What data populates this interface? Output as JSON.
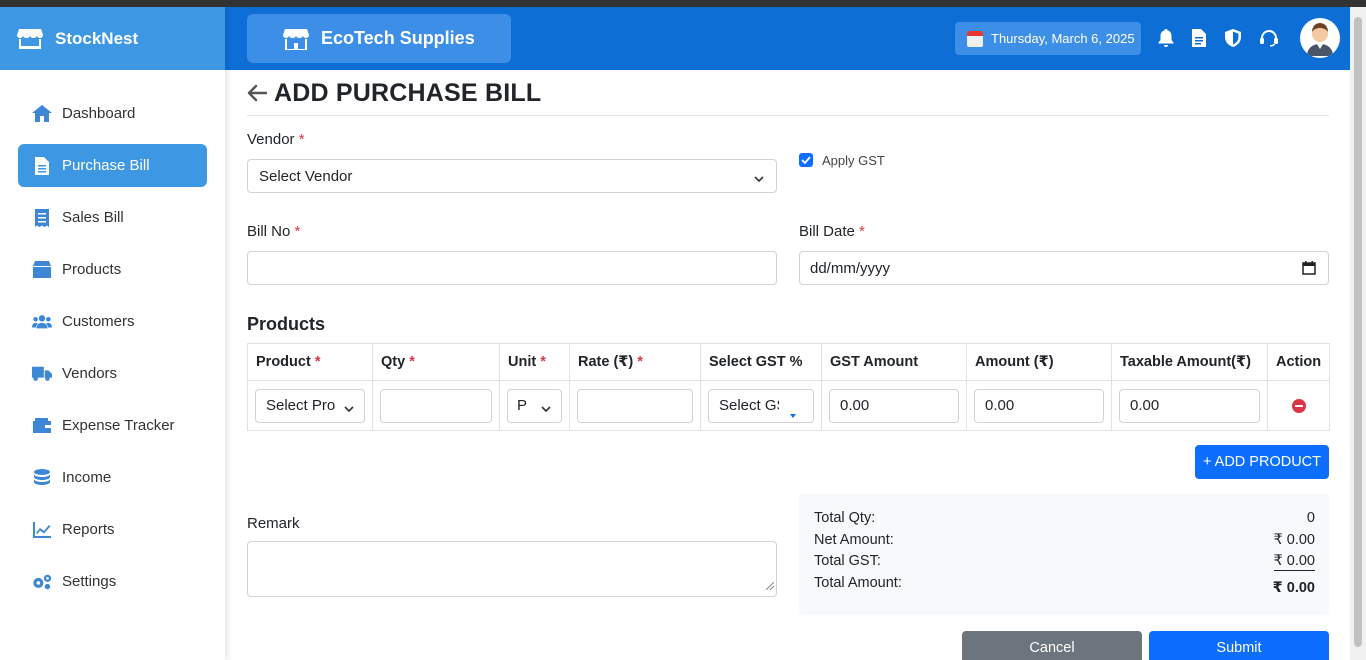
{
  "app": {
    "name": "StockNest"
  },
  "header": {
    "company": "EcoTech Supplies",
    "date": "Thursday, March 6, 2025"
  },
  "sidebar": {
    "items": [
      {
        "label": "Dashboard",
        "icon": "home-icon"
      },
      {
        "label": "Purchase Bill",
        "icon": "file-icon",
        "active": true
      },
      {
        "label": "Sales Bill",
        "icon": "receipt-icon"
      },
      {
        "label": "Products",
        "icon": "box-icon"
      },
      {
        "label": "Customers",
        "icon": "users-icon"
      },
      {
        "label": "Vendors",
        "icon": "truck-icon"
      },
      {
        "label": "Expense Tracker",
        "icon": "wallet-icon"
      },
      {
        "label": "Income",
        "icon": "coins-icon"
      },
      {
        "label": "Reports",
        "icon": "chart-line-icon"
      },
      {
        "label": "Settings",
        "icon": "gears-icon"
      }
    ]
  },
  "page": {
    "title": "ADD PURCHASE BILL"
  },
  "form": {
    "vendor_label": "Vendor",
    "vendor_value": "Select Vendor",
    "apply_gst_label": "Apply GST",
    "apply_gst_checked": true,
    "bill_no_label": "Bill No",
    "bill_no_value": "",
    "bill_date_label": "Bill Date",
    "bill_date_placeholder": "dd/mm/yyyy",
    "required_mark": "*"
  },
  "products": {
    "heading": "Products",
    "columns": [
      "Product",
      "Qty",
      "Unit",
      "Rate (₹)",
      "Select GST %",
      "GST Amount",
      "Amount (₹)",
      "Taxable Amount(₹)",
      "Action"
    ],
    "row": {
      "product": "Select Pro",
      "qty": "",
      "unit": "Pc",
      "rate": "",
      "gst": "Select GST",
      "gst_amount": "0.00",
      "amount": "0.00",
      "taxable": "0.00"
    },
    "add_button": "+ ADD PRODUCT"
  },
  "remark": {
    "label": "Remark",
    "value": ""
  },
  "summary": {
    "total_qty_label": "Total Qty:",
    "total_qty": "0",
    "net_amount_label": "Net Amount:",
    "net_amount": "₹ 0.00",
    "total_gst_label": "Total GST:",
    "total_gst": "₹ 0.00",
    "total_amount_label": "Total Amount:",
    "total_amount": "₹ 0.00"
  },
  "actions": {
    "cancel": "Cancel",
    "submit": "Submit"
  },
  "colors": {
    "brand": "#3d97e3",
    "header": "#0d6fd6",
    "primary": "#0d6efd",
    "danger": "#dc3545",
    "secondary": "#6c757d"
  }
}
